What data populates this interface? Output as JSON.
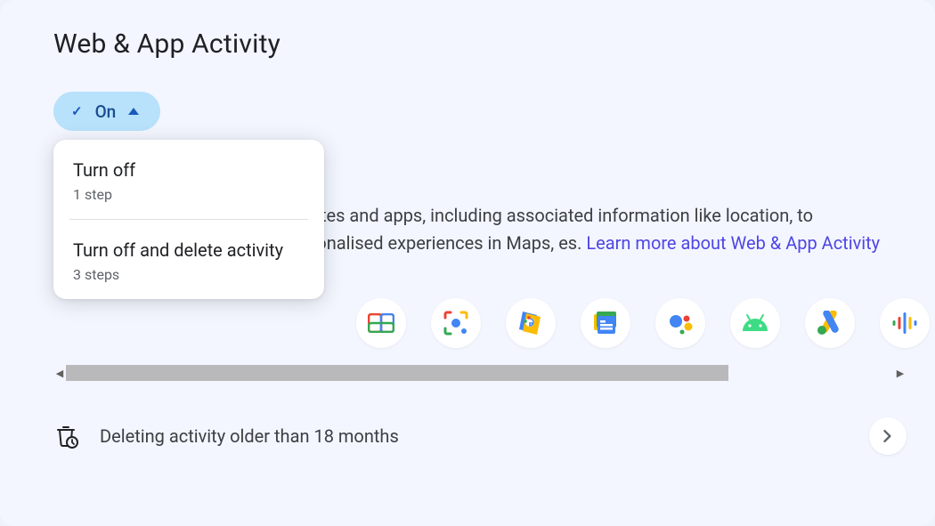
{
  "page": {
    "title": "Web & App Activity"
  },
  "status_pill": {
    "label": "On"
  },
  "dropdown": {
    "items": [
      {
        "title": "Turn off",
        "subtitle": "1 step"
      },
      {
        "title": "Turn off and delete activity",
        "subtitle": "3 steps"
      }
    ]
  },
  "description": {
    "text_fragment": "tes and apps, including associated information like location, to recommendations and more personalised experiences in Maps, es. ",
    "link_text": "Learn more about Web & App Activity"
  },
  "app_icons": [
    {
      "name": "google-tv"
    },
    {
      "name": "google-lens"
    },
    {
      "name": "google-shopping"
    },
    {
      "name": "google-news"
    },
    {
      "name": "google-assistant"
    },
    {
      "name": "android"
    },
    {
      "name": "google-ads"
    },
    {
      "name": "google-podcasts"
    }
  ],
  "auto_delete": {
    "label": "Deleting activity older than 18 months"
  }
}
